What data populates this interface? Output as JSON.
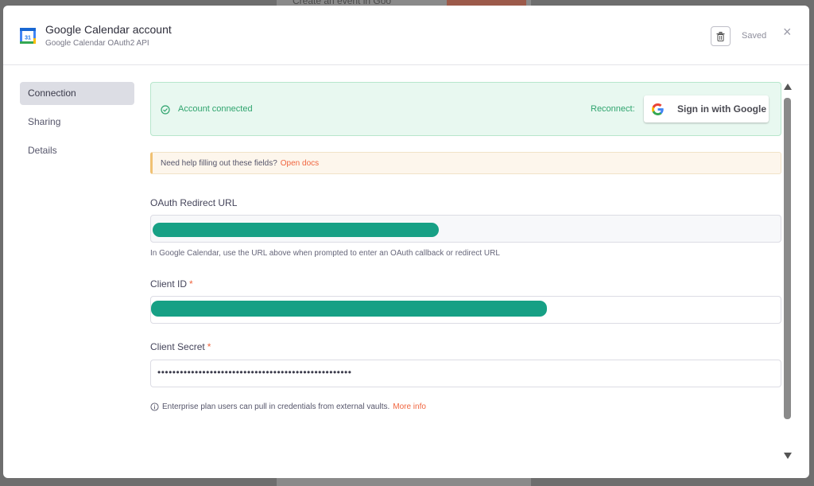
{
  "background": {
    "title": "Create an event in Goo"
  },
  "header": {
    "title": "Google Calendar account",
    "subtitle": "Google Calendar OAuth2 API",
    "icon": "google-calendar-icon",
    "calendar_day": "31",
    "saved_label": "Saved"
  },
  "sidebar": {
    "items": [
      {
        "label": "Connection",
        "active": true
      },
      {
        "label": "Sharing",
        "active": false
      },
      {
        "label": "Details",
        "active": false
      }
    ]
  },
  "connection": {
    "status_text": "Account connected",
    "reconnect_label": "Reconnect:",
    "google_button_label": "Sign in with Google"
  },
  "help": {
    "text": "Need help filling out these fields?",
    "link": "Open docs"
  },
  "fields": {
    "redirect": {
      "label": "OAuth Redirect URL",
      "hint": "In Google Calendar, use the URL above when prompted to enter an OAuth callback or redirect URL"
    },
    "client_id": {
      "label": "Client ID",
      "required_mark": "*"
    },
    "client_secret": {
      "label": "Client Secret",
      "required_mark": "*",
      "value": "••••••••••••••••••••••••••••••••••••••••••••••••••••"
    }
  },
  "info": {
    "text": "Enterprise plan users can pull in credentials from external vaults.",
    "link": "More info"
  },
  "colors": {
    "accent": "#f0653f",
    "success": "#2fa46e",
    "redaction": "#17a085"
  }
}
